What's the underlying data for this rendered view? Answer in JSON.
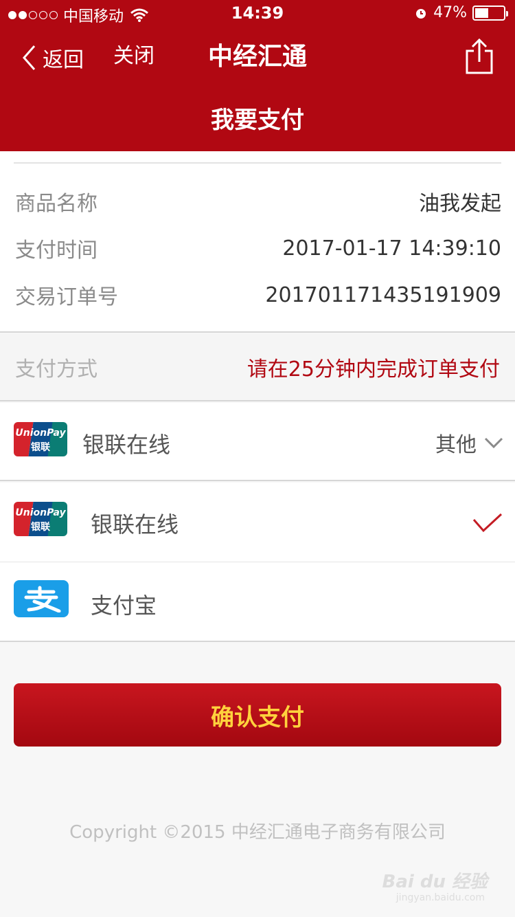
{
  "status_bar": {
    "carrier": "中国移动",
    "time": "14:39",
    "battery_text": "47%",
    "battery_level": 0.47
  },
  "nav": {
    "back_label": "返回",
    "close_label": "关闭",
    "app_title": "中经汇通",
    "page_title": "我要支付"
  },
  "order": {
    "rows": [
      {
        "label": "商品名称",
        "value": "油我发起"
      },
      {
        "label": "支付时间",
        "value": "2017-01-17 14:39:10"
      },
      {
        "label": "交易订单号",
        "value": "20170117143519190​9"
      }
    ]
  },
  "payment": {
    "header_label": "支付方式",
    "notice": "请在25分钟内完成订单支付",
    "primary_method": "银联在线",
    "other_label": "其他",
    "options": [
      {
        "name": "银联在线",
        "selected": true
      },
      {
        "name": "支付宝",
        "selected": false
      }
    ],
    "unionpay_logo_text": "UnionPay",
    "unionpay_logo_cn": "银联"
  },
  "confirm_label": "确认支付",
  "copyright": "Copyright ©2015 中经汇通电子商务有限公司",
  "watermark": "Bai du 经验",
  "watermark_sub": "jingyan.baidu.com",
  "colors": {
    "brand": "#b10812",
    "confirm_text": "#ffd23d",
    "alipay": "#1a9ee8"
  }
}
